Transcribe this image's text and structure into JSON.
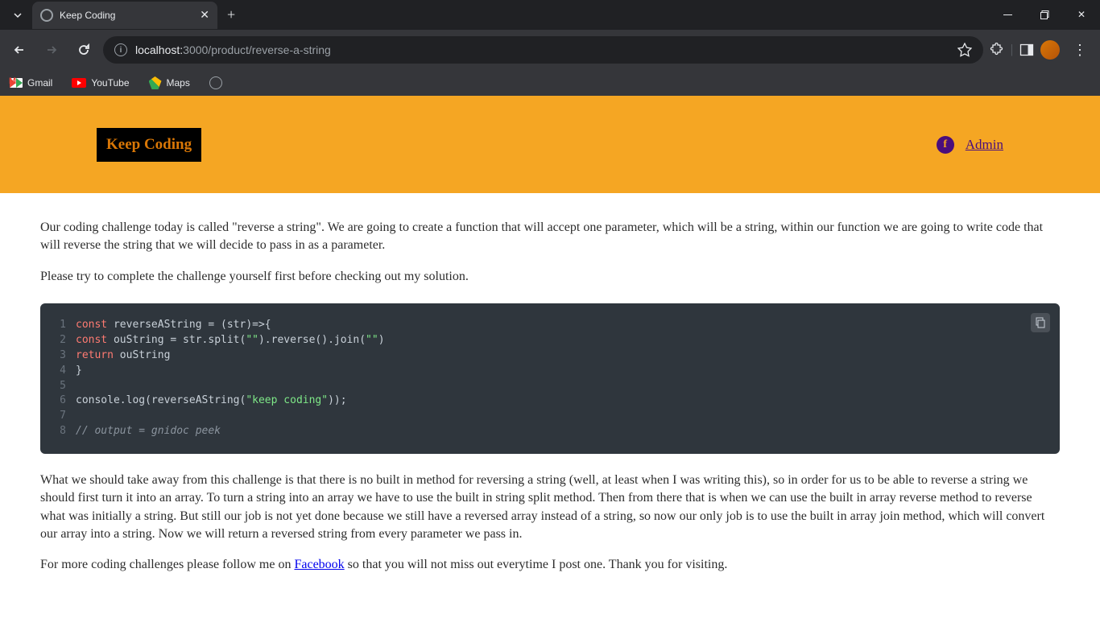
{
  "browser": {
    "tab_title": "Keep Coding",
    "url_host": "localhost:",
    "url_port_path": "3000/product/reverse-a-string",
    "bookmarks": [
      "Gmail",
      "YouTube",
      "Maps"
    ]
  },
  "header": {
    "logo_text": "Keep Coding",
    "admin_label": "Admin"
  },
  "article": {
    "intro": "Our coding challenge today is called \"reverse a string\". We are going to create a function that will accept one parameter, which will be a string, within our function we are going to write code that will reverse the string that we will decide to pass in as a parameter.",
    "instruction": "Please try to complete the challenge yourself first before checking out my solution.",
    "explanation": "What we should take away from this challenge is that there is no built in method for reversing a string (well, at least when I was writing this), so in order for us to be able to reverse a string we should first turn it into an array. To turn a string into an array we have to use the built in string split method. Then from there that is when we can use the built in array reverse method to reverse what was initially a string. But still our job is not yet done because we still have a reversed array instead of a string, so now our only job is to use the built in array join method, which will convert our array into a string. Now we will return a reversed string from every parameter we pass in.",
    "footer_prefix": "For more coding challenges please follow me on ",
    "footer_link": "Facebook",
    "footer_suffix": " so that you will not miss out everytime I post one. Thank you for visiting."
  },
  "code": {
    "lines": [
      {
        "n": 1,
        "segments": [
          {
            "t": "const",
            "c": "keyword"
          },
          {
            "t": " reverseAString = (str)=>{",
            "c": "text"
          }
        ]
      },
      {
        "n": 2,
        "segments": [
          {
            "t": "const",
            "c": "keyword"
          },
          {
            "t": " ouString = str.split(",
            "c": "text"
          },
          {
            "t": "\"\"",
            "c": "string"
          },
          {
            "t": ").reverse().join(",
            "c": "text"
          },
          {
            "t": "\"\"",
            "c": "string"
          },
          {
            "t": ")",
            "c": "text"
          }
        ]
      },
      {
        "n": 3,
        "segments": [
          {
            "t": "return",
            "c": "keyword"
          },
          {
            "t": " ouString",
            "c": "text"
          }
        ]
      },
      {
        "n": 4,
        "segments": [
          {
            "t": "}",
            "c": "text"
          }
        ]
      },
      {
        "n": 5,
        "segments": []
      },
      {
        "n": 6,
        "segments": [
          {
            "t": "console.log(reverseAString(",
            "c": "text"
          },
          {
            "t": "\"keep coding\"",
            "c": "string"
          },
          {
            "t": "));",
            "c": "text"
          }
        ]
      },
      {
        "n": 7,
        "segments": []
      },
      {
        "n": 8,
        "segments": [
          {
            "t": "// output = gnidoc peek",
            "c": "comment"
          }
        ]
      }
    ]
  }
}
